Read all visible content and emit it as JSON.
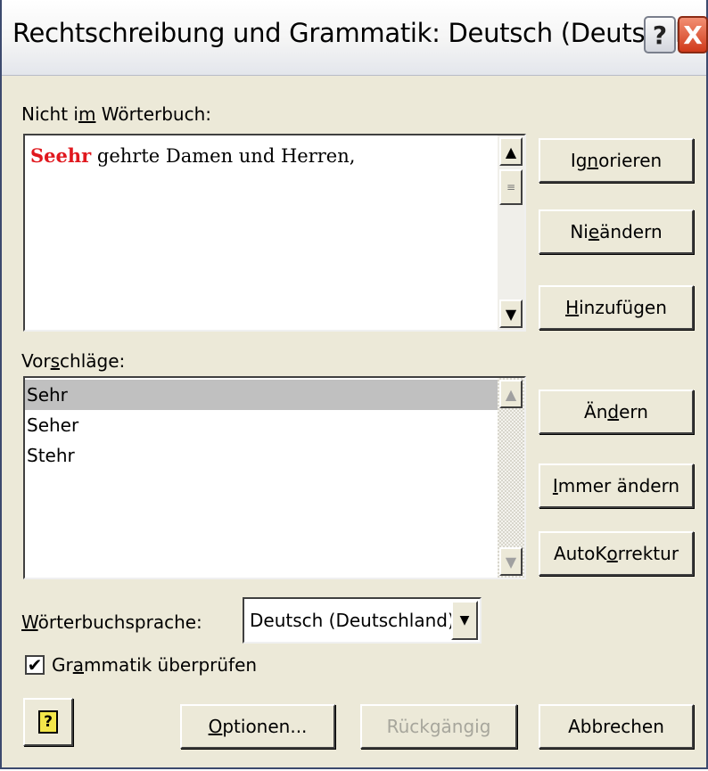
{
  "window": {
    "title": "Rechtschreibung und Grammatik: Deutsch (Deutschland)",
    "help_glyph": "?",
    "close_glyph": "X"
  },
  "not_in_dictionary": {
    "label_pre": "Nicht i",
    "label_u": "m",
    "label_post": " Wörterbuch:",
    "error_word": "Seehr",
    "rest_text": " gehrte Damen und Herren,"
  },
  "suggestions": {
    "label_pre": "Vor",
    "label_u": "s",
    "label_post": "chläge:",
    "items": [
      "Sehr",
      "Seher",
      "Stehr"
    ],
    "selected_index": 0
  },
  "buttons": {
    "ignore": {
      "pre": "Ig",
      "u": "n",
      "post": "orieren"
    },
    "never_change": {
      "pre": "Ni",
      "u": "e",
      "post": " ändern"
    },
    "add": {
      "pre": "",
      "u": "H",
      "post": "inzufügen"
    },
    "change": {
      "pre": "Än",
      "u": "d",
      "post": "ern"
    },
    "always_change": {
      "pre": "",
      "u": "I",
      "post": "mmer ändern"
    },
    "autocorrect": {
      "pre": "AutoK",
      "u": "o",
      "post": "rrektur"
    },
    "options": {
      "pre": "",
      "u": "O",
      "post": "ptionen..."
    },
    "undo": {
      "label": "Rückgängig"
    },
    "cancel": {
      "label": "Abbrechen"
    }
  },
  "dictionary_language": {
    "label_pre": "",
    "label_u": "W",
    "label_post": "örterbuchsprache:",
    "value": "Deutsch (Deutschland)"
  },
  "check_grammar": {
    "checked": true,
    "check_glyph": "✔",
    "label_pre": "Gr",
    "label_u": "a",
    "label_post": "mmatik überprüfen"
  },
  "help_button": {
    "glyph": "?"
  },
  "colors": {
    "error_word": "#e0181e",
    "dialog_bg": "#ece9d8",
    "selection": "#c0c0c0"
  }
}
